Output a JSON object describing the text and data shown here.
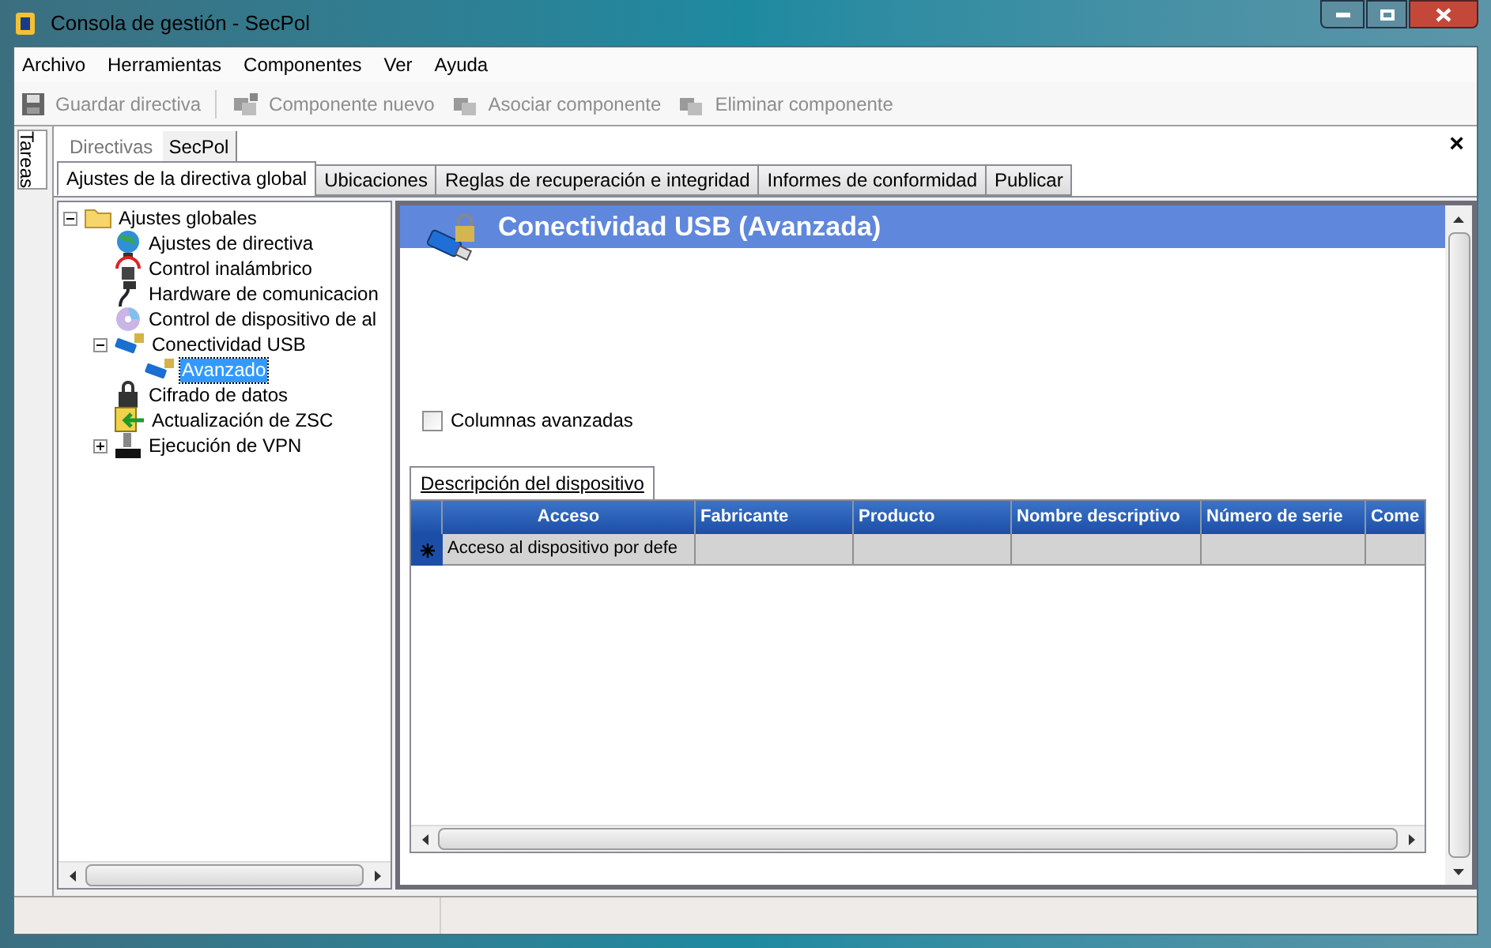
{
  "window": {
    "title": "Consola de gestión - SecPol"
  },
  "menu": [
    "Archivo",
    "Herramientas",
    "Componentes",
    "Ver",
    "Ayuda"
  ],
  "toolbar": [
    {
      "label": "Guardar directiva",
      "kind": "save",
      "disabled": true
    },
    {
      "label": "Componente nuevo",
      "kind": "new",
      "disabled": true
    },
    {
      "label": "Asociar componente",
      "kind": "link",
      "disabled": true
    },
    {
      "label": "Eliminar componente",
      "kind": "delete",
      "disabled": true
    }
  ],
  "side_tab": "Tareas",
  "documents": [
    {
      "label": "Directivas",
      "selected": false
    },
    {
      "label": "SecPol",
      "selected": true
    }
  ],
  "close_glyph": "×",
  "tabs": [
    {
      "label": "Ajustes de la directiva global",
      "selected": true
    },
    {
      "label": "Ubicaciones",
      "selected": false
    },
    {
      "label": "Reglas de recuperación e integridad",
      "selected": false
    },
    {
      "label": "Informes de conformidad",
      "selected": false
    },
    {
      "label": "Publicar",
      "selected": false
    }
  ],
  "tree": [
    {
      "label": "Ajustes globales",
      "kind": "folder",
      "selected": false,
      "expanded": true,
      "children": [
        {
          "label": "Ajustes de directiva",
          "kind": "globe",
          "selected": false
        },
        {
          "label": "Control inalámbrico",
          "kind": "wireless",
          "selected": false
        },
        {
          "label": "Hardware de comunicacion",
          "kind": "cable",
          "selected": false
        },
        {
          "label": "Control de dispositivo de al",
          "kind": "disc",
          "selected": false
        },
        {
          "label": "Conectividad USB",
          "kind": "usb",
          "selected": false,
          "expanded": true,
          "children": [
            {
              "label": "Avanzado",
              "kind": "usb",
              "selected": true
            }
          ]
        },
        {
          "label": "Cifrado de datos",
          "kind": "lock",
          "selected": false
        },
        {
          "label": "Actualización de ZSC",
          "kind": "update",
          "selected": false
        },
        {
          "label": "Ejecución de VPN",
          "kind": "vpn",
          "selected": false,
          "expanded": false
        }
      ]
    }
  ],
  "panel": {
    "title": "Conectividad USB (Avanzada)",
    "checkbox": {
      "label": "Columnas avanzadas",
      "checked": false
    },
    "grid_tab": "Descripción del dispositivo",
    "columns": [
      "Acceso",
      "Fabricante",
      "Producto",
      "Nombre descriptivo",
      "Número de serie",
      "Come"
    ],
    "rows": [
      {
        "cells": [
          "Acceso al dispositivo por defe"
        ]
      }
    ]
  }
}
